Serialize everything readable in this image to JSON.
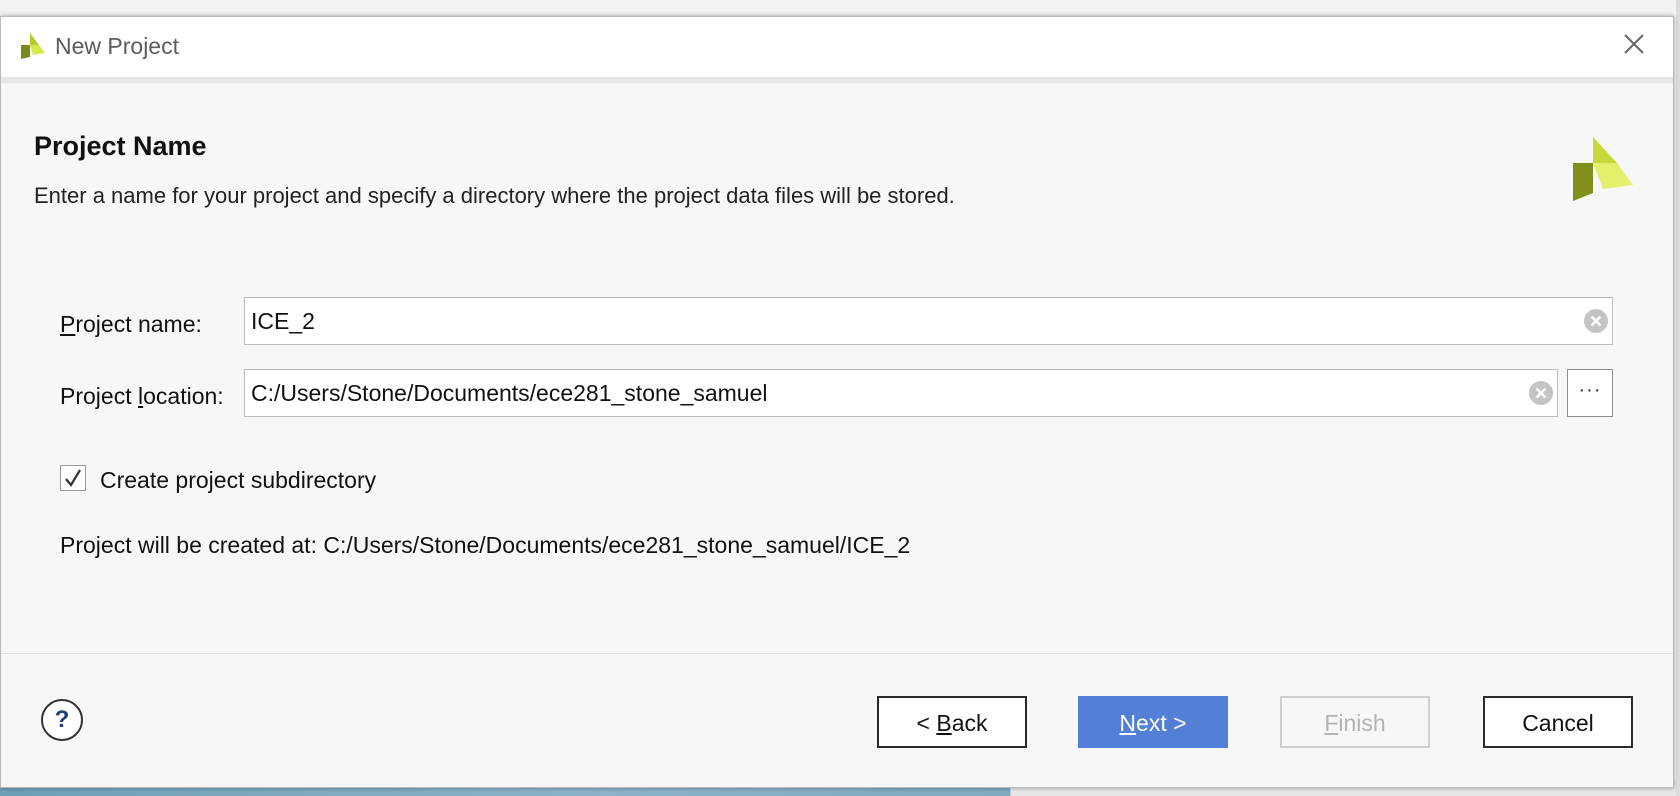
{
  "window": {
    "title": "New Project"
  },
  "header": {
    "title": "Project Name",
    "description": "Enter a name for your project and specify a directory where the project data files will be stored."
  },
  "form": {
    "project_name": {
      "label_underlined": "P",
      "label_rest": "roject name:",
      "value": "ICE_2"
    },
    "project_location": {
      "label_before": "Project ",
      "label_underlined": "l",
      "label_after": "ocation:",
      "value": "C:/Users/Stone/Documents/ece281_stone_samuel",
      "browse_label": "···"
    },
    "create_subdirectory": {
      "label": "Create project subdirectory",
      "checked": true
    },
    "created_at": "Project will be created at: C:/Users/Stone/Documents/ece281_stone_samuel/ICE_2"
  },
  "footer": {
    "help_label": "?",
    "back": {
      "prefix": "< ",
      "underlined": "B",
      "rest": "ack"
    },
    "next": {
      "underlined": "N",
      "rest": "ext >"
    },
    "finish": {
      "underlined": "F",
      "rest": "inish"
    },
    "cancel": "Cancel"
  },
  "colors": {
    "accent": "#5380d6",
    "logo_yellow_green": "#d7e84a",
    "logo_dark": "#7a8a18"
  },
  "icons": {
    "title": "vivado-logo-icon",
    "close": "close-icon",
    "clear": "clear-circle-icon",
    "help": "help-icon",
    "check": "checkmark-icon"
  }
}
